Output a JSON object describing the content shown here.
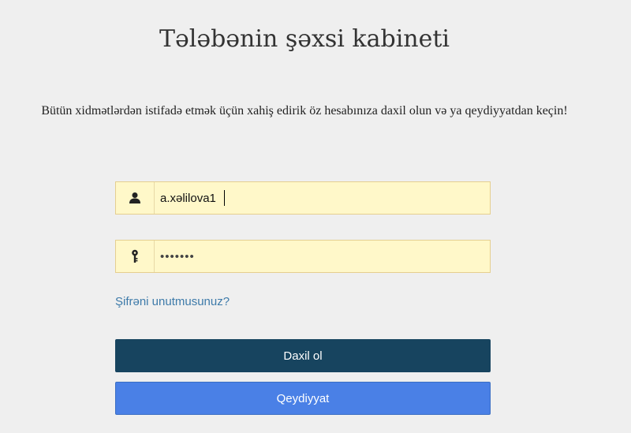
{
  "page": {
    "title": "Tələbənin şəxsi kabineti",
    "intro": "Bütün xidmətlərdən istifadə etmək üçün xahiş edirik öz hesabınıza daxil olun və ya qeydiyyatdan keçin!"
  },
  "login_form": {
    "username": {
      "value": "a.xəlilova1",
      "icon": "user-icon"
    },
    "password": {
      "value": "•••••••",
      "icon": "key-icon"
    },
    "forgot_password_label": "Şifrəni unutmusunuz?",
    "login_button_label": "Daxil ol",
    "register_button_label": "Qeydiyyat"
  },
  "colors": {
    "background": "#efefef",
    "input_background": "#fff8c9",
    "input_border": "#e5cf8f",
    "link": "#3d7aa9",
    "login_button": "#17445f",
    "register_button": "#4a80e6"
  }
}
